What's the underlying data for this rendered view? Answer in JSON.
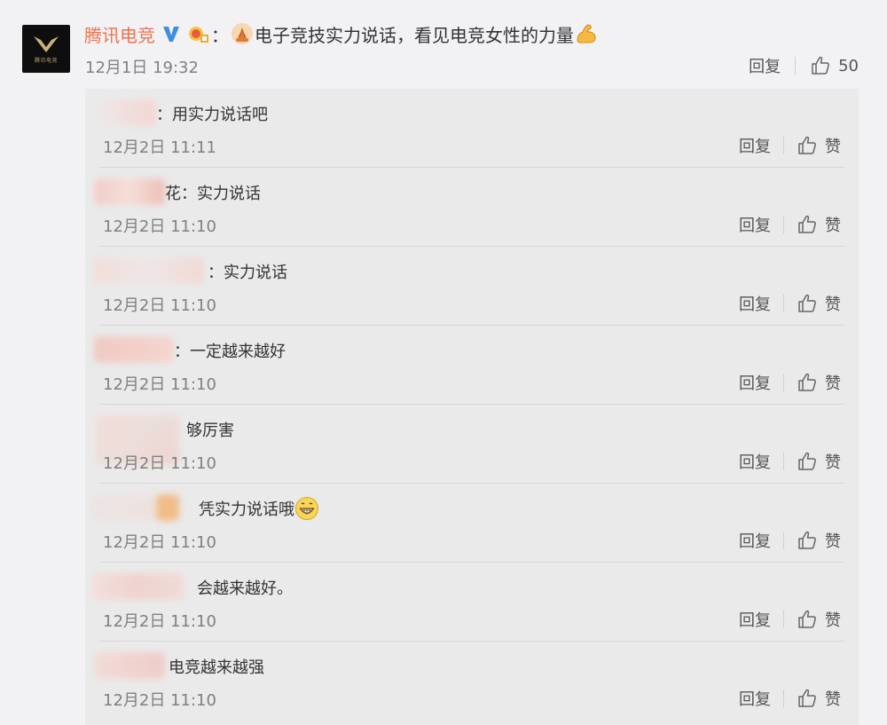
{
  "post": {
    "author": "腾讯电竞",
    "text": "电子竞技实力说话，看见电竞女性的力量",
    "time": "12月1日 19:32",
    "reply_label": "回复",
    "like_count": "50",
    "avatar_caption": "腾讯电竞",
    "colors": {
      "author": "#eb7350",
      "time": "#808080",
      "text": "#333333"
    }
  },
  "replies": [
    {
      "text": "：用实力说话吧",
      "time": "12月2日 11:11",
      "reply_label": "回复",
      "like_label": "赞"
    },
    {
      "text": "花：实力说话",
      "time": "12月2日 11:10",
      "reply_label": "回复",
      "like_label": "赞"
    },
    {
      "text": "：实力说话",
      "time": "12月2日 11:10",
      "reply_label": "回复",
      "like_label": "赞"
    },
    {
      "text": "：一定越来越好",
      "time": "12月2日 11:10",
      "reply_label": "回复",
      "like_label": "赞"
    },
    {
      "text": "够厉害",
      "time": "12月2日 11:10",
      "reply_label": "回复",
      "like_label": "赞"
    },
    {
      "text": "凭实力说话哦",
      "time": "12月2日 11:10",
      "reply_label": "回复",
      "like_label": "赞"
    },
    {
      "text": "会越来越好。",
      "time": "12月2日 11:10",
      "reply_label": "回复",
      "like_label": "赞"
    },
    {
      "text": "电竞越来越强",
      "time": "12月2日 11:10",
      "reply_label": "回复",
      "like_label": "赞"
    }
  ],
  "icons": {
    "verified": "verified-v-icon",
    "medal": "fan-medal-icon",
    "pray": "pray-emoji-icon",
    "muscle": "muscle-emoji-icon",
    "grin": "grin-emoji-icon",
    "like": "thumbs-up-icon"
  }
}
